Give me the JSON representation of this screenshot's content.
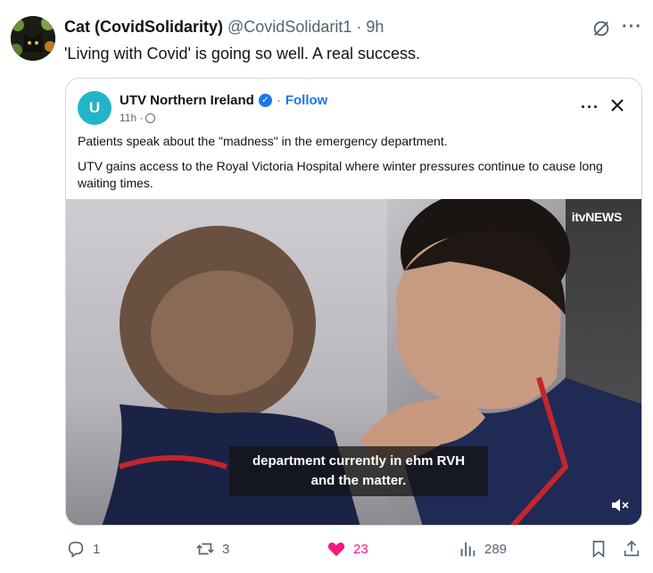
{
  "tweet": {
    "author_name": "Cat (CovidSolidarity)",
    "handle": "@CovidSolidarit1",
    "separator": "·",
    "time": "9h",
    "text": "'Living with Covid' is going so well. A real success."
  },
  "embed": {
    "page_name": "UTV Northern Ireland",
    "separator": "·",
    "follow_label": "Follow",
    "time": "11h ·",
    "logo_text": "U",
    "line1": "Patients speak about the \"madness\" in the emergency department.",
    "line2": "UTV gains access to the Royal Victoria Hospital where winter pressures continue to cause long waiting times.",
    "video": {
      "watermark": "itvNEWS",
      "caption_line1": "department currently in ehm RVH",
      "caption_line2": "and the matter."
    }
  },
  "actions": {
    "replies": "1",
    "reposts": "3",
    "likes": "23",
    "views": "289"
  },
  "colors": {
    "like_pink": "#f91880",
    "secondary_text": "#536471",
    "follow_blue": "#1877f2",
    "utv_teal": "#22b5c9"
  },
  "icons": [
    "grok-icon",
    "more-icon",
    "verified-icon",
    "globe-icon",
    "close-icon",
    "mute-icon",
    "reply-icon",
    "repost-icon",
    "heart-icon",
    "views-icon",
    "bookmark-icon",
    "share-icon"
  ]
}
